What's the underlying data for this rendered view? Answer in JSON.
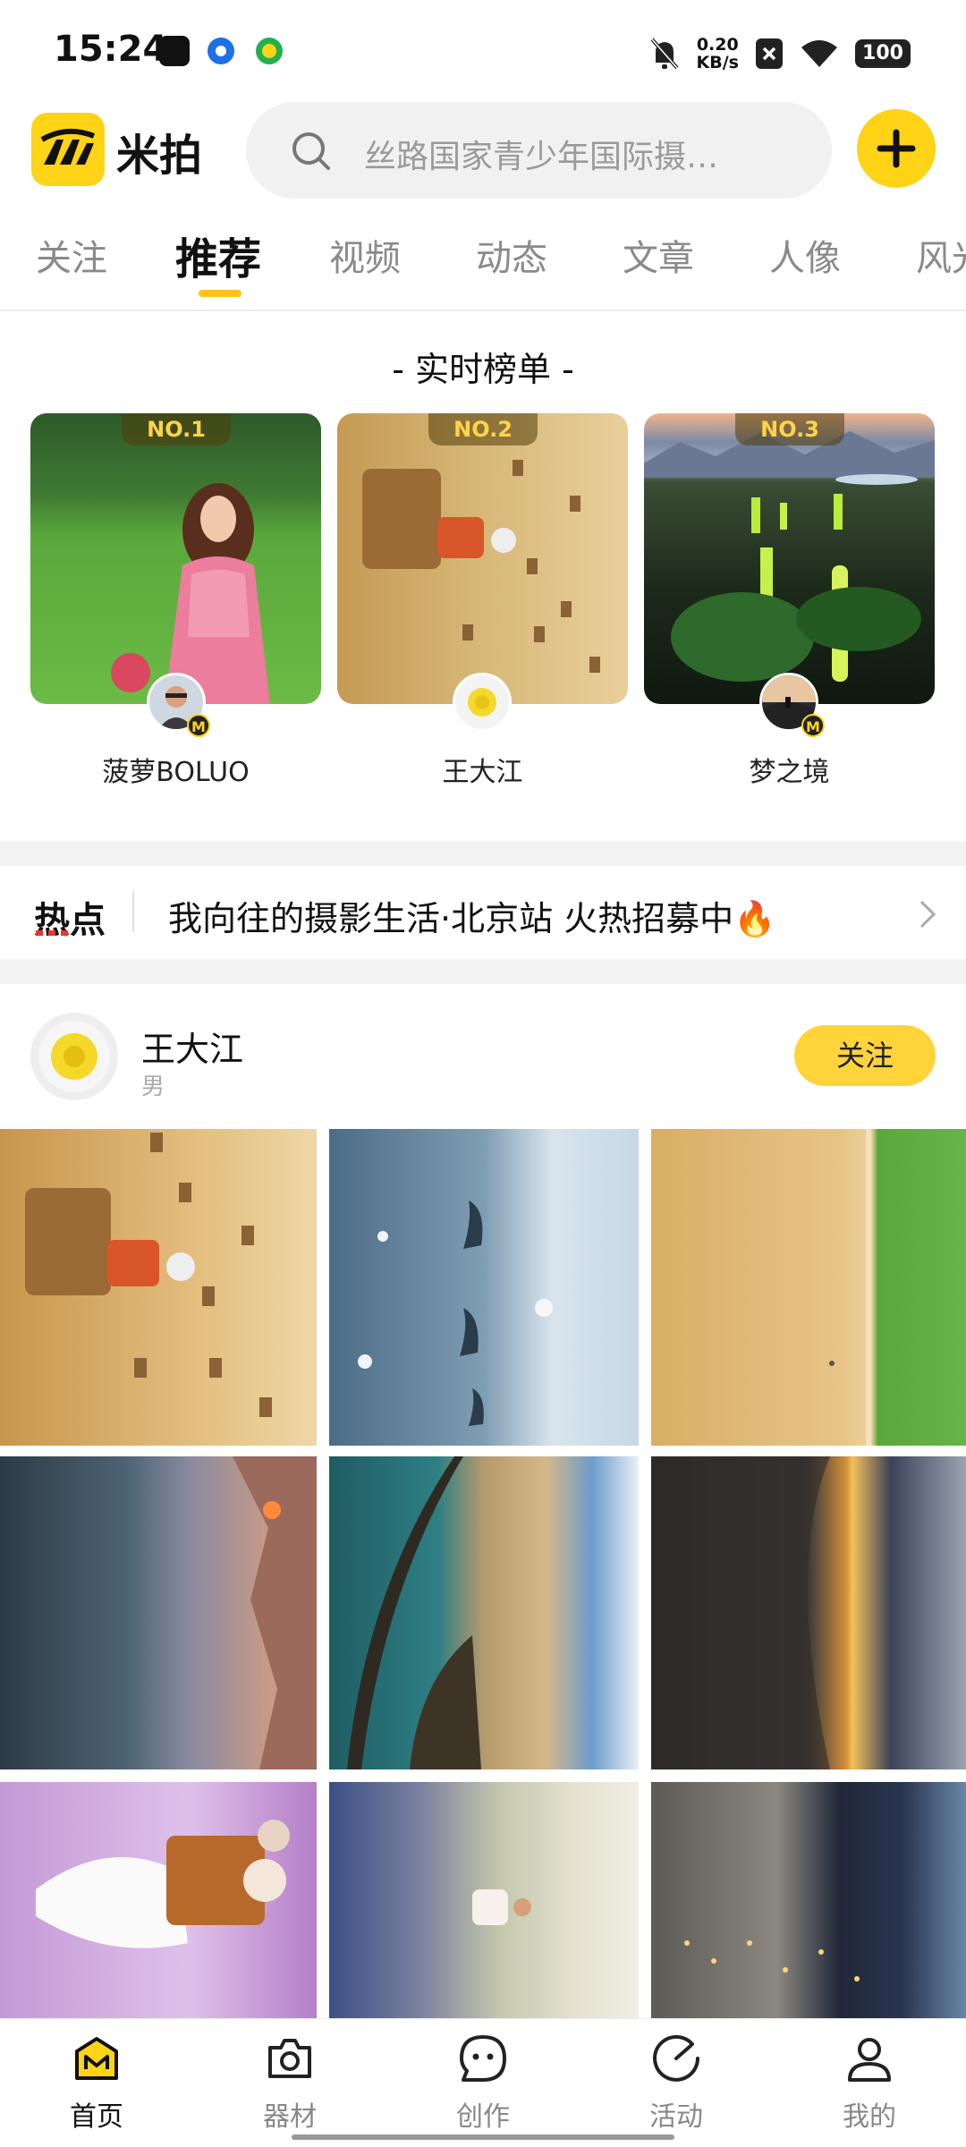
{
  "status_bar": {
    "time": "15:24",
    "net_speed_value": "0.20",
    "net_speed_unit": "KB/s",
    "battery": "100"
  },
  "header": {
    "logo_text": "米拍",
    "search_placeholder": "丝路国家青少年国际摄…"
  },
  "tabs": [
    {
      "label": "关注",
      "active": false
    },
    {
      "label": "推荐",
      "active": true
    },
    {
      "label": "视频",
      "active": false
    },
    {
      "label": "动态",
      "active": false
    },
    {
      "label": "文章",
      "active": false
    },
    {
      "label": "人像",
      "active": false
    },
    {
      "label": "风光",
      "active": false
    }
  ],
  "ranking": {
    "title": "- 实时榜单 -",
    "items": [
      {
        "rank": "NO.1",
        "name": "菠萝BOLUO",
        "badge": "M"
      },
      {
        "rank": "NO.2",
        "name": "王大江",
        "badge": ""
      },
      {
        "rank": "NO.3",
        "name": "梦之境",
        "badge": "M"
      }
    ]
  },
  "hot": {
    "label": "热点",
    "text": "我向往的摄影生活·北京站 火热招募中🔥"
  },
  "post": {
    "author": "王大江",
    "gender": "男",
    "follow_label": "关注"
  },
  "bottom_nav": [
    {
      "label": "首页",
      "icon": "home-icon",
      "active": true
    },
    {
      "label": "器材",
      "icon": "camera-icon",
      "active": false
    },
    {
      "label": "创作",
      "icon": "chat-bubble-icon",
      "active": false
    },
    {
      "label": "活动",
      "icon": "activity-icon",
      "active": false
    },
    {
      "label": "我的",
      "icon": "profile-icon",
      "active": false
    }
  ],
  "colors": {
    "accent": "#ffd316",
    "tab_underline": "#ffc21a",
    "follow_button": "#ffd33a"
  }
}
